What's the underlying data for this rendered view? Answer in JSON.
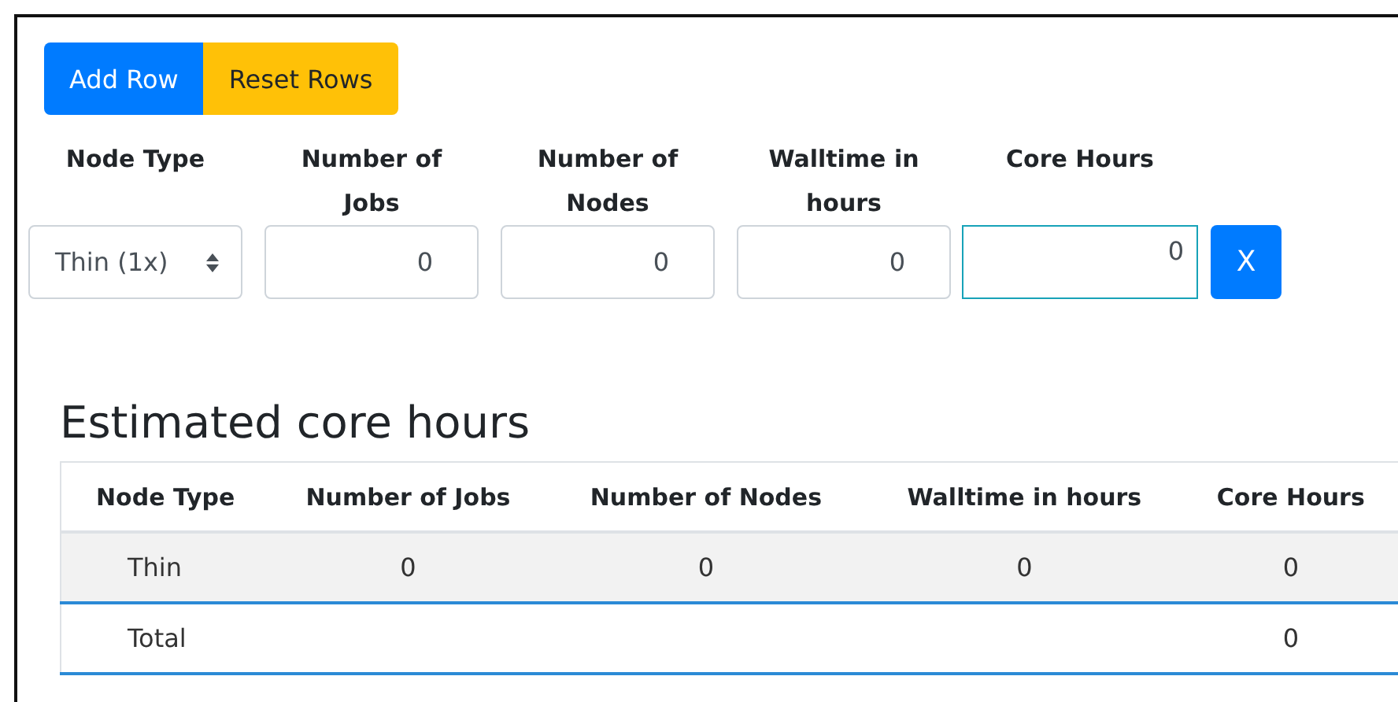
{
  "buttons": [
    {
      "label": "Add Row",
      "kind": "primary"
    },
    {
      "label": "Reset Rows",
      "kind": "warning"
    }
  ],
  "form": {
    "columns": [
      "Node Type",
      "Number of Jobs",
      "Number of Nodes",
      "Walltime in hours",
      "Core Hours"
    ],
    "select": {
      "value": "Thin (1x)"
    },
    "inputs": [
      {
        "value": "0",
        "focused": false
      },
      {
        "value": "0",
        "focused": false
      },
      {
        "value": "0",
        "focused": false
      },
      {
        "value": "0",
        "focused": true
      }
    ],
    "remove_button": "X"
  },
  "summary": {
    "title": "Estimated core hours",
    "columns": [
      "Node Type",
      "Number of Jobs",
      "Number of Nodes",
      "Walltime in hours",
      "Core Hours"
    ],
    "rows": [
      {
        "kind": "data",
        "cells": [
          "Thin",
          "0",
          "0",
          "0",
          "0"
        ]
      },
      {
        "kind": "total",
        "cells": [
          "Total",
          "",
          "",
          "",
          "0"
        ]
      }
    ]
  }
}
